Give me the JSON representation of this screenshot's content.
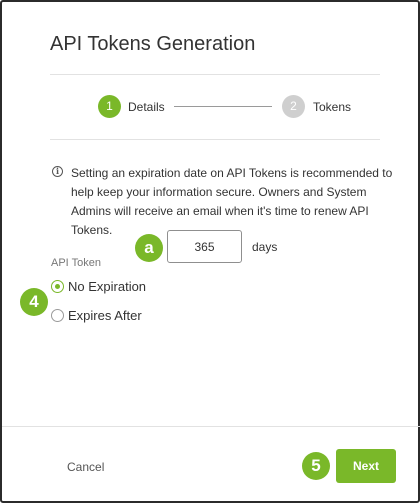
{
  "dialog": {
    "title": "API Tokens Generation"
  },
  "stepper": {
    "steps": [
      {
        "number": "1",
        "label": "Details",
        "state": "active"
      },
      {
        "number": "2",
        "label": "Tokens",
        "state": "inactive"
      }
    ]
  },
  "info": {
    "icon": "info-icon",
    "text": "Setting an expiration date on API Tokens is recommended to help keep your information secure. Owners and System Admins will receive an email when it's time to renew API Tokens."
  },
  "expiration": {
    "days_value": "365",
    "days_unit": "days"
  },
  "api_token": {
    "label": "API Token",
    "options": [
      {
        "label": "No Expiration",
        "checked": true
      },
      {
        "label": "Expires After",
        "checked": false
      }
    ]
  },
  "footer": {
    "cancel_label": "Cancel",
    "next_label": "Next"
  },
  "callouts": {
    "a": "a",
    "four": "4",
    "five": "5"
  },
  "colors": {
    "accent": "#7ab829",
    "inactive_step": "#cfcfcf",
    "text": "#333333"
  }
}
